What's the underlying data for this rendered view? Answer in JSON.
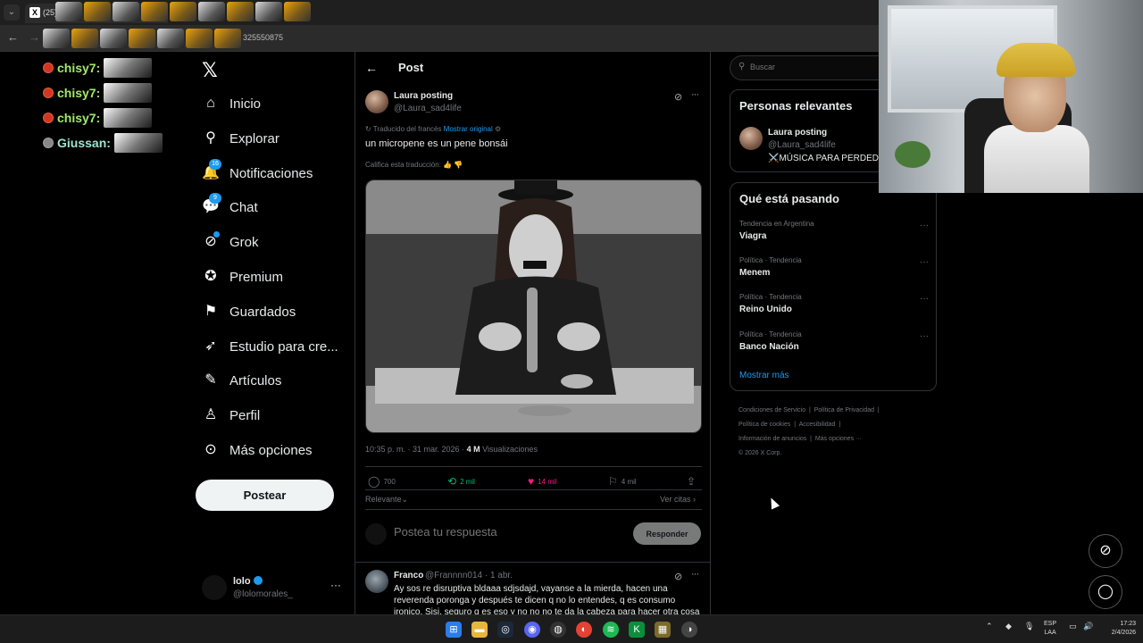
{
  "browser": {
    "tab_title": "(25) La",
    "url_fragment": "325550875"
  },
  "stream_chat": [
    {
      "user": "chisy7:"
    },
    {
      "user": "chisy7:"
    },
    {
      "user": "chisy7:"
    },
    {
      "user": "Giussan:"
    }
  ],
  "sidebar": {
    "logo": "𝕏",
    "items": [
      {
        "label": "Inicio",
        "icon": "home-icon",
        "glyph": "⌂"
      },
      {
        "label": "Explorar",
        "icon": "search-icon",
        "glyph": "⚲"
      },
      {
        "label": "Notificaciones",
        "icon": "bell-icon",
        "glyph": "🔔",
        "badge": "16"
      },
      {
        "label": "Chat",
        "icon": "chat-bubble-icon",
        "glyph": "💬",
        "badge": "9"
      },
      {
        "label": "Grok",
        "icon": "grok-icon",
        "glyph": "⊘",
        "dot": true
      },
      {
        "label": "Premium",
        "icon": "verified-badge-icon",
        "glyph": "✪"
      },
      {
        "label": "Guardados",
        "icon": "bookmark-icon",
        "glyph": "⚑"
      },
      {
        "label": "Estudio para cre...",
        "icon": "rocket-icon",
        "glyph": "➶"
      },
      {
        "label": "Artículos",
        "icon": "article-icon",
        "glyph": "✎"
      },
      {
        "label": "Perfil",
        "icon": "person-icon",
        "glyph": "♙"
      },
      {
        "label": "Más opciones",
        "icon": "more-circle-icon",
        "glyph": "⊙"
      }
    ],
    "post_button": "Postear",
    "account": {
      "name": "lolo",
      "handle": "@lolomorales_",
      "more": "···"
    }
  },
  "main": {
    "back": "←",
    "title": "Post",
    "tweet": {
      "author_name": "Laura posting",
      "author_handle": "@Laura_sad4life",
      "translated_from": "Traducido del francés",
      "show_original": "Mostrar original",
      "text": "un micropene es un pene bonsái",
      "rate_translation": "Califica esta traducción:",
      "time": "10:35 p. m. · 31 mar. 2026 ·",
      "views_count": "4 M",
      "views_label": "Visualizaciones",
      "replies": "700",
      "reposts": "2 mil",
      "likes": "14 mil",
      "bookmarks": "4 mil"
    },
    "sort_label": "Relevante",
    "quotes_label": "Ver citas",
    "reply_placeholder": "Postea tu respuesta",
    "reply_button": "Responder",
    "comment": {
      "author_name": "Franco",
      "author_handle": "@Frannnn014 · 1 abr.",
      "text": "Ay sos re disruptiva bldaaa sdjsdajd, vayanse a la mierda, hacen una reverenda poronga y después te dicen q no lo entendes, q es consumo ironico. Sisi, seguro q es eso y no no no te da la cabeza para hacer otra cosa"
    }
  },
  "right": {
    "search_placeholder": "Buscar",
    "relevant_title": "Personas relevantes",
    "relevant_person": {
      "name": "Laura posting",
      "handle": "@Laura_sad4life",
      "bio": "⚔️MÚSICA PARA PERDEDO"
    },
    "trends_title": "Qué está pasando",
    "trends": [
      {
        "category": "Tendencia en Argentina",
        "name": "Viagra"
      },
      {
        "category": "Política · Tendencia",
        "name": "Menem"
      },
      {
        "category": "Política · Tendencia",
        "name": "Reino Unido"
      },
      {
        "category": "Política · Tendencia",
        "name": "Banco Nación"
      }
    ],
    "show_more": "Mostrar más",
    "footer": {
      "terms": "Condiciones de Servicio",
      "privacy": "Política de Privacidad",
      "cookies": "Política de cookies",
      "accessibility": "Accesibilidad",
      "ads": "Información de anuncios",
      "more": "Más opciones ···",
      "copyright": "© 2026 X Corp."
    }
  },
  "taskbar": {
    "lang_top": "ESP",
    "lang_bottom": "LAA",
    "time": "17:23",
    "date": "2/4/2026"
  },
  "colors": {
    "accent": "#1d9bf0",
    "repost": "#00ba7c",
    "like": "#f91880"
  }
}
